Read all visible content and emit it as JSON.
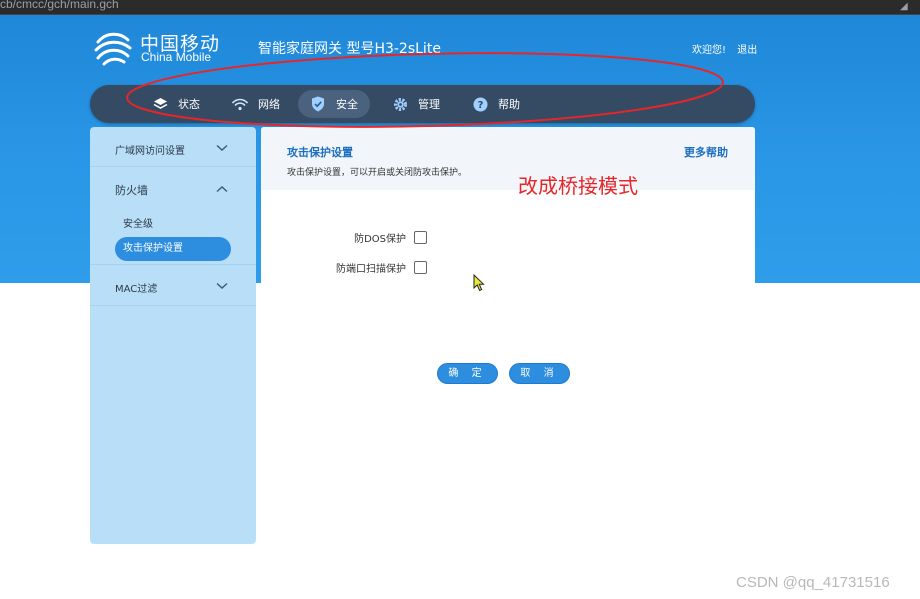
{
  "browser": {
    "url": "cb/cmcc/gch/main.gch"
  },
  "header": {
    "logo_cn": "中国移动",
    "logo_en": "China Mobile",
    "gateway_title": "智能家庭网关  型号H3-2sLite",
    "welcome": "欢迎您!",
    "logout": "退出"
  },
  "nav": {
    "items": [
      {
        "label": "状态",
        "icon": "layers-icon"
      },
      {
        "label": "网络",
        "icon": "wifi-icon"
      },
      {
        "label": "安全",
        "icon": "shield-icon",
        "active": true
      },
      {
        "label": "管理",
        "icon": "gear-icon"
      },
      {
        "label": "帮助",
        "icon": "question-icon"
      }
    ]
  },
  "sidebar": {
    "wan_access": "广域网访问设置",
    "firewall": "防火墙",
    "security_level": "安全级",
    "attack_protection": "攻击保护设置",
    "mac_filter": "MAC过滤"
  },
  "content": {
    "title": "攻击保护设置",
    "description": "攻击保护设置，可以开启或关闭防攻击保护。",
    "more_help": "更多帮助",
    "dos_label": "防DOS保护",
    "dos_checked": false,
    "portscan_label": "防端口扫描保护",
    "portscan_checked": false,
    "confirm": "确 定",
    "cancel": "取 消"
  },
  "annotation": {
    "text": "改成桥接模式",
    "color": "#e5262a"
  },
  "watermark": "CSDN @qq_41731516",
  "colors": {
    "hero_blue": "#2a97e6",
    "nav_bg": "#354a63",
    "sidebar_bg": "#b9def7",
    "button_blue": "#2d8ddf",
    "title_blue": "#1d6fc2"
  }
}
